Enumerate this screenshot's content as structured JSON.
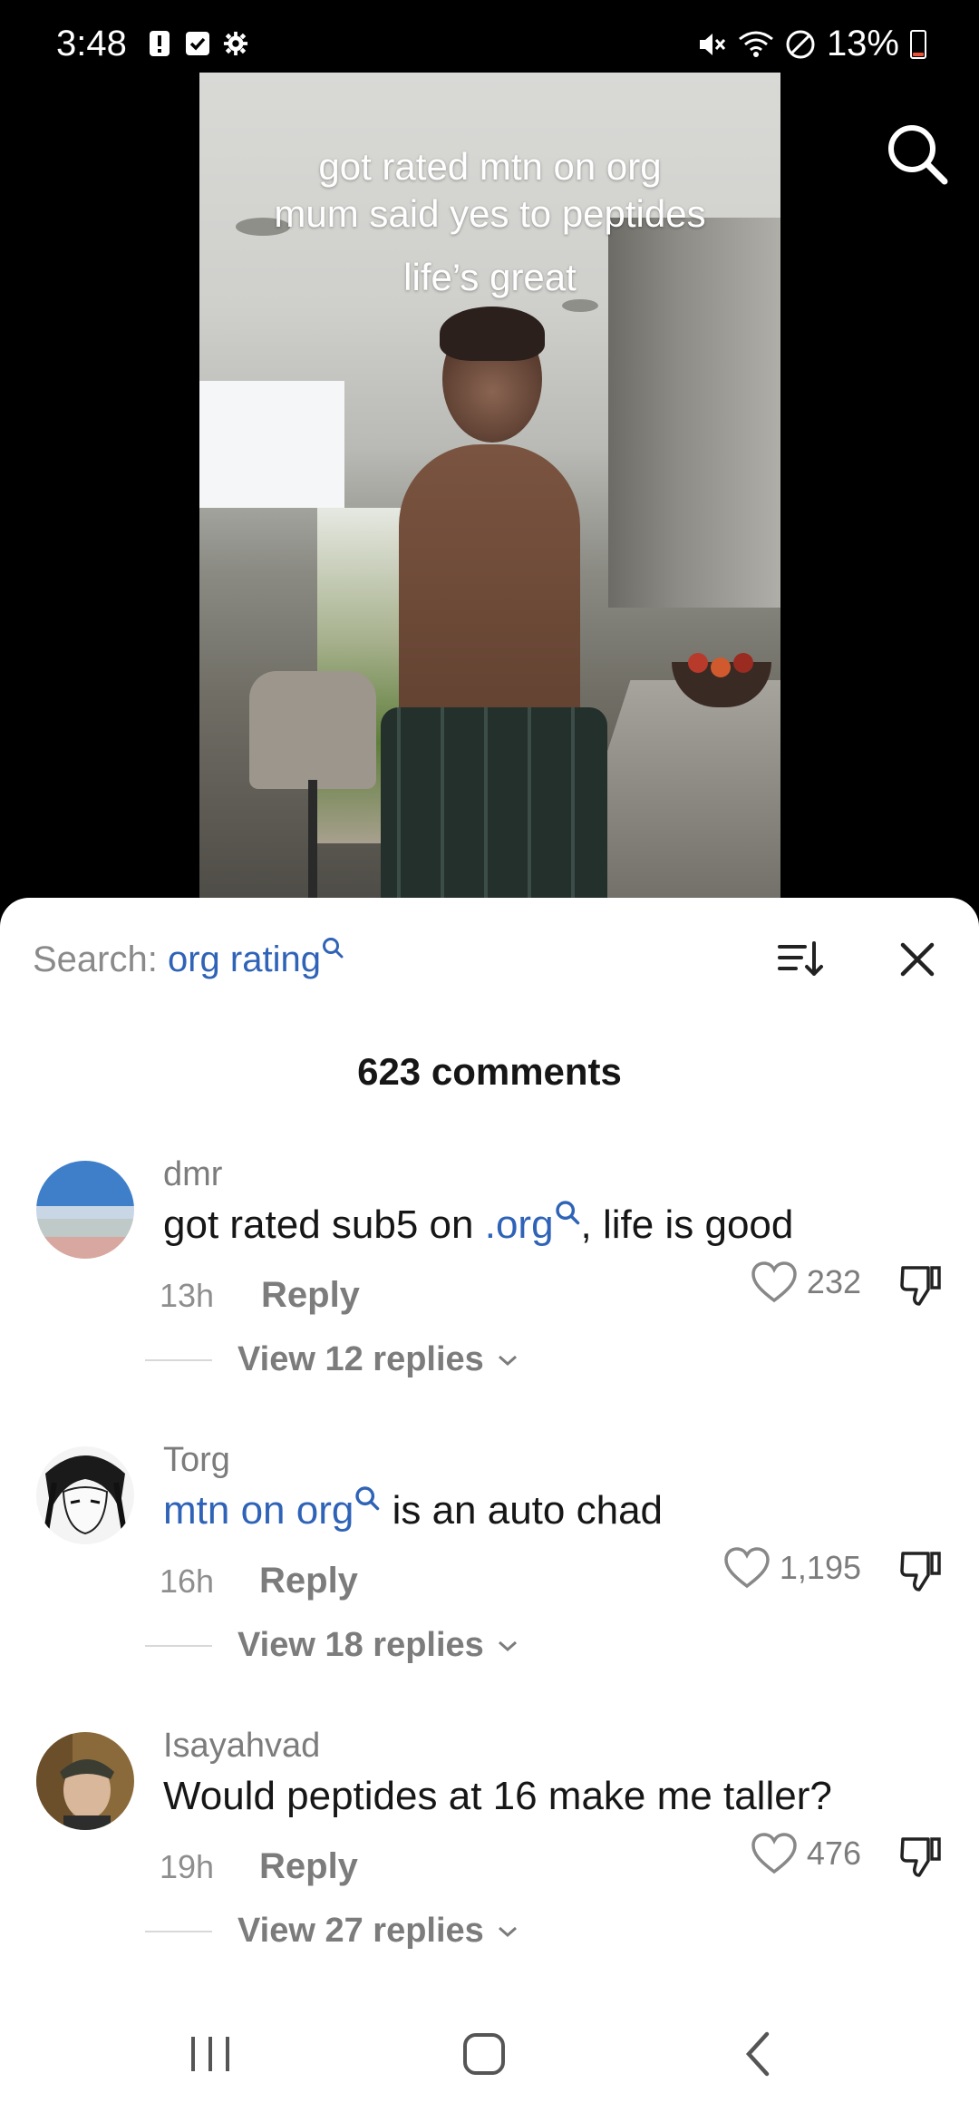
{
  "status_bar": {
    "time": "3:48",
    "battery": "13%",
    "battery_level": 0.13,
    "left_icons": [
      "alert-icon",
      "checkbox-icon",
      "settings-gear-icon"
    ],
    "right_icons": [
      "mute-icon",
      "wifi-icon",
      "do-not-disturb-icon",
      "battery-icon"
    ]
  },
  "video": {
    "caption_lines": [
      "got rated mtn on org",
      "mum said yes to peptides",
      "life’s great"
    ]
  },
  "comments_sheet": {
    "search_label": "Search: ",
    "search_query": "org rating",
    "count_label": "623 comments",
    "reply_label": "Reply",
    "comments": [
      {
        "username": "dmr",
        "text_before": "got rated sub5 on ",
        "link": ".org",
        "text_after": ", life is good",
        "time": "13h",
        "likes": "232",
        "view_replies": "View 12 replies"
      },
      {
        "username": "Torg",
        "text_before": "",
        "link": "mtn on org",
        "text_after": " is an auto chad",
        "time": "16h",
        "likes": "1,195",
        "view_replies": "View 18 replies"
      },
      {
        "username": "Isayahvad",
        "text_before": "Would peptides at 16 make me taller?",
        "link": "",
        "text_after": "",
        "time": "19h",
        "likes": "476",
        "view_replies": "View 27 replies"
      }
    ]
  },
  "colors": {
    "link": "#2f63b7",
    "muted_text": "#7c7c7c",
    "primary_text": "#161616"
  }
}
